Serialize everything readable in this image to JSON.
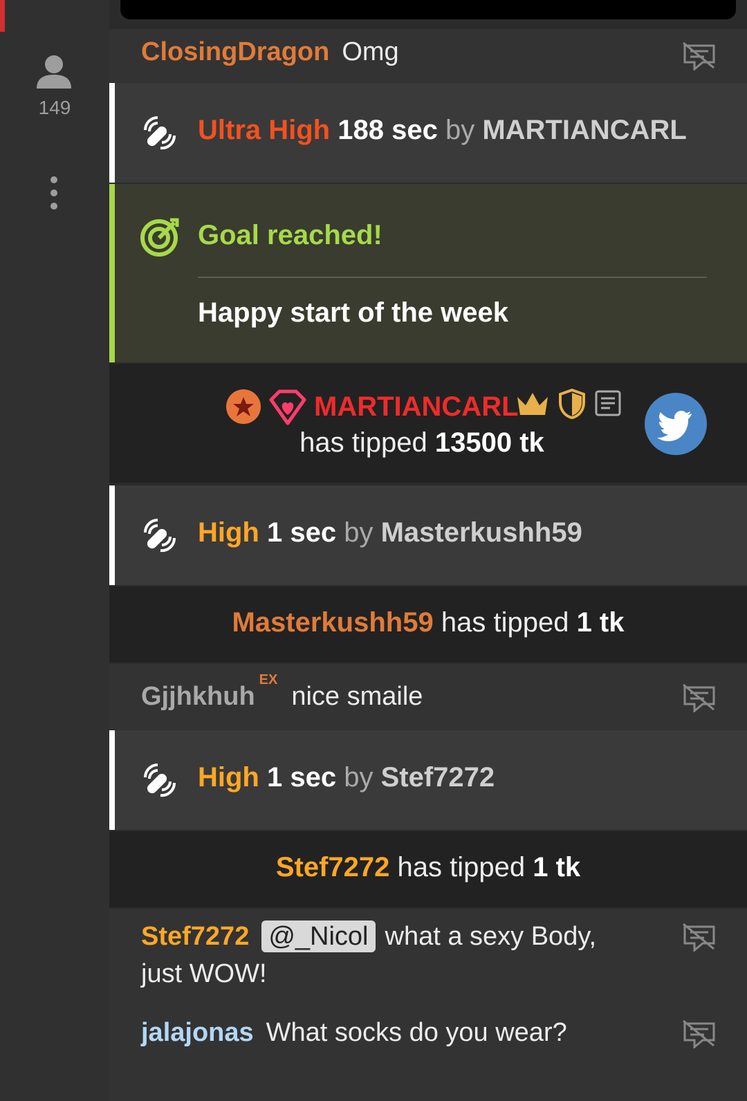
{
  "sidebar": {
    "viewer_count": "149",
    "accent_color": "#d32f2f",
    "viewer_icon": "user-icon",
    "menu_icon": "more-vertical-icon"
  },
  "chat": {
    "message_1": {
      "username": "ClosingDragon",
      "text": "Omg",
      "username_color": "#e07b39"
    },
    "event_1": {
      "level": "Ultra High",
      "duration": "188 sec",
      "by": "by",
      "user": "MARTIANCARL",
      "icon": "vibration-icon"
    },
    "goal": {
      "title": "Goal reached!",
      "subtitle": "Happy start of the week",
      "icon": "target-icon",
      "accent": "#a7d94a"
    },
    "tip_1": {
      "username": "MARTIANCARL",
      "prefix": "has tipped",
      "amount": "13500 tk",
      "badges": [
        "star-badge-icon",
        "heart-gem-icon",
        "crown-icon",
        "shield-icon",
        "notes-icon"
      ],
      "share_icon": "twitter-icon"
    },
    "event_2": {
      "level": "High",
      "duration": "1 sec",
      "by": "by",
      "user": "Masterkushh59",
      "icon": "vibration-icon"
    },
    "tip_2": {
      "username": "Masterkushh59",
      "prefix": "has tipped",
      "amount": "1 tk"
    },
    "message_2": {
      "username": "Gjjhkhuh",
      "badge": "EX",
      "text": "nice smaile"
    },
    "event_3": {
      "level": "High",
      "duration": "1 sec",
      "by": "by",
      "user": "Stef7272",
      "icon": "vibration-icon"
    },
    "tip_3": {
      "username": "Stef7272",
      "prefix": "has tipped",
      "amount": "1 tk"
    },
    "message_3": {
      "username": "Stef7272",
      "mention": "@_Nicol",
      "text_line1": "what a sexy Body,",
      "text_line2": "just WOW!"
    },
    "message_4": {
      "username": "jalajonas",
      "text": "What socks do you wear?"
    }
  }
}
